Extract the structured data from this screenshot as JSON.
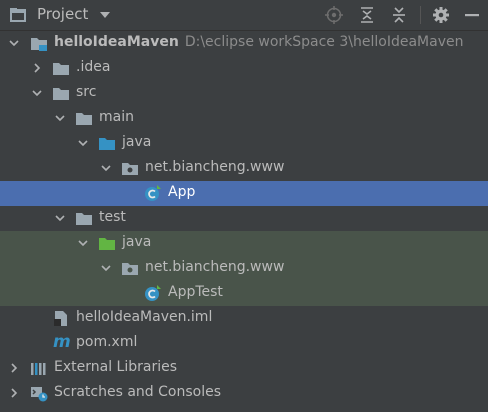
{
  "header": {
    "title": "Project",
    "icons": [
      "project-view-icon",
      "dropdown-caret-icon",
      "locate-icon",
      "expand-all-icon",
      "collapse-all-icon",
      "settings-gear-icon",
      "hide-minimize-icon"
    ]
  },
  "tree": {
    "root": {
      "label": "helloIdeaMaven",
      "path": "D:\\eclipse workSpace 3\\helloIdeaMaven"
    },
    "idea": "idea_placeholder",
    "src": "src",
    "main": "main",
    "main_java": "java",
    "main_package": "net.biancheng.www",
    "app_class": "App",
    "test": "test",
    "test_java": "java",
    "test_package": "net.biancheng.www",
    "apptest_class": "AppTest",
    "iml": "helloIdeaMaven.iml",
    "pom": "pom.xml",
    "external_libraries": "External Libraries",
    "scratches": "Scratches and Consoles"
  },
  "colors": {
    "background": "#3c3f41",
    "selection": "#4b6eaf",
    "test_highlight": "#49544a",
    "source_folder": "#3592c4",
    "test_folder": "#62b543"
  }
}
